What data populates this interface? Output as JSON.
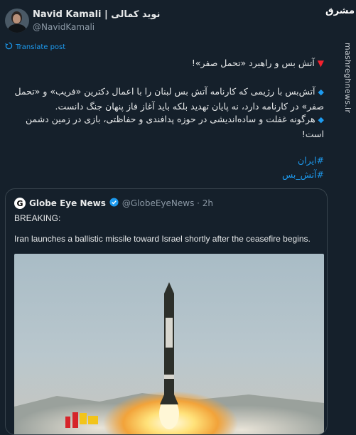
{
  "author": {
    "display_name": "Navid Kamali | نوید کمالی",
    "handle": "@NavidKamali"
  },
  "brand_logo_text": "مشرق",
  "translate_label": "Translate post",
  "tweet": {
    "headline": "آتش بس و راهبرد «تحمل صفر»!",
    "para2": "آتش‌بس با رژیمی که کارنامه آتش بس لبنان  را با اعمال دکترین «فریب» و «تحمل صفر» در کارنامه دارد، نه پایان تهدید بلکه باید آغاز فاز پنهان جنگ دانست.",
    "para3": "هرگونه غفلت و ساده‌اندیشی در حوزه پدافندی و حفاظتی، بازی در زمین دشمن است!",
    "hashtag1": "#ایران",
    "hashtag2": "#آتش_بس"
  },
  "quoted": {
    "name": "Globe Eye News",
    "meta": "@GlobeEyeNews · 2h",
    "line1": "BREAKING:",
    "line2": "Iran launches a ballistic missile toward Israel shortly after the ceasefire begins."
  },
  "watermark": "mashreghnews.ir",
  "colors": {
    "background": "#15202b",
    "text": "#e7e9ea",
    "secondary": "#8b98a5",
    "link": "#1d9bf0",
    "border": "#38444d"
  }
}
